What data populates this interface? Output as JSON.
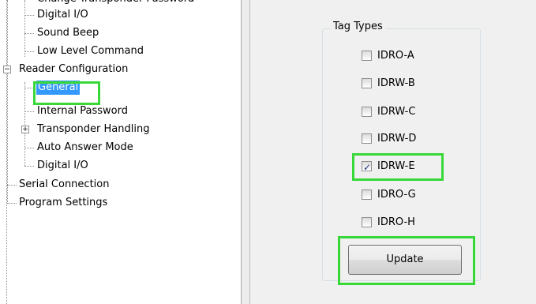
{
  "tree": {
    "items": [
      {
        "label": "Change Transponder Password",
        "level": 2,
        "expander": null
      },
      {
        "label": "Digital I/O",
        "level": 2,
        "expander": null
      },
      {
        "label": "Sound Beep",
        "level": 2,
        "expander": null
      },
      {
        "label": "Low Level Command",
        "level": 2,
        "expander": null
      },
      {
        "label": "Reader Configuration",
        "level": 1,
        "expander": "minus"
      },
      {
        "label": "General",
        "level": 2,
        "expander": null,
        "selected": true
      },
      {
        "label": "Internal Password",
        "level": 2,
        "expander": null
      },
      {
        "label": "Transponder Handling",
        "level": 2,
        "expander": "plus"
      },
      {
        "label": "Auto Answer Mode",
        "level": 2,
        "expander": null
      },
      {
        "label": "Digital I/O",
        "level": 2,
        "expander": null
      },
      {
        "label": "Serial Connection",
        "level": 1,
        "expander": null
      },
      {
        "label": "Program Settings",
        "level": 1,
        "expander": null
      }
    ]
  },
  "tag_types": {
    "title": "Tag Types",
    "options": [
      {
        "label": "IDRO-A",
        "checked": false
      },
      {
        "label": "IDRW-B",
        "checked": false
      },
      {
        "label": "IDRW-C",
        "checked": false
      },
      {
        "label": "IDRW-D",
        "checked": false
      },
      {
        "label": "IDRW-E",
        "checked": true
      },
      {
        "label": "IDRO-G",
        "checked": false
      },
      {
        "label": "IDRO-H",
        "checked": false
      }
    ],
    "update_label": "Update"
  },
  "colors": {
    "highlight": "#37d838",
    "selection": "#3399ff",
    "panel_bg": "#f0f0f0"
  },
  "icons": {
    "collapse": "minus-box-icon",
    "expand": "plus-box-icon",
    "checkmark": "checkmark-icon"
  }
}
